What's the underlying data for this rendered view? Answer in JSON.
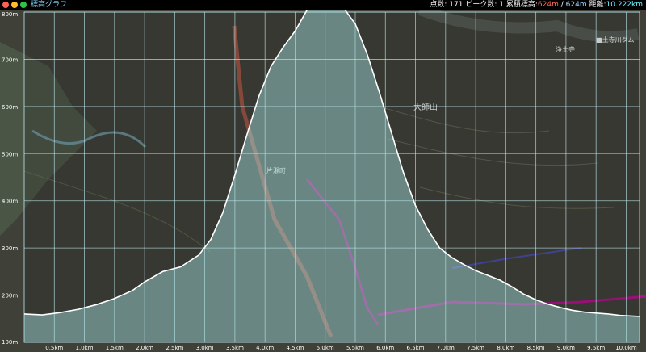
{
  "app": {
    "title": "標高グラフ",
    "stats": {
      "points_label": "点数:",
      "points": "171",
      "peaks_label": "ピーク数:",
      "peaks": "1",
      "gain_label": "累積標高:",
      "gain_up": "624m",
      "sep": "/",
      "gain_down": "624m",
      "distance_label": "距離:",
      "distance": "10.222km"
    }
  },
  "map_labels": {
    "mountain": "大師山",
    "dam": "■土寺川ダム",
    "temple": "浄土寺",
    "town": "片瀬町"
  },
  "colors": {
    "area_fill": "#a8e6e6",
    "line": "#ffffff",
    "grid": "#bfe9f2",
    "route": "#b0108a"
  },
  "chart_data": {
    "type": "area",
    "title": "",
    "xlabel": "",
    "ylabel": "",
    "xlim": [
      0,
      10.222
    ],
    "ylim": [
      100,
      800
    ],
    "x_tick_labels": [
      "0.5km",
      "1.0km",
      "1.5km",
      "2.0km",
      "2.5km",
      "3.0km",
      "3.5km",
      "4.0km",
      "4.5km",
      "5.0km",
      "5.5km",
      "6.0km",
      "6.5km",
      "7.0km",
      "7.5km",
      "8.0km",
      "8.5km",
      "9.0km",
      "9.5km",
      "10.0km"
    ],
    "x_tick_values": [
      0.5,
      1.0,
      1.5,
      2.0,
      2.5,
      3.0,
      3.5,
      4.0,
      4.5,
      5.0,
      5.5,
      6.0,
      6.5,
      7.0,
      7.5,
      8.0,
      8.5,
      9.0,
      9.5,
      10.0
    ],
    "y_tick_labels": [
      "800m",
      "700m",
      "600m",
      "500m",
      "400m",
      "300m",
      "200m",
      "100m"
    ],
    "y_tick_values": [
      800,
      700,
      600,
      500,
      400,
      300,
      200,
      100
    ],
    "grid": true,
    "series": [
      {
        "x": [
          0,
          0.3,
          0.6,
          0.9,
          1.2,
          1.5,
          1.8,
          2.0,
          2.3,
          2.6,
          2.9,
          3.1,
          3.3,
          3.5,
          3.7,
          3.9,
          4.1,
          4.3,
          4.5,
          4.7,
          4.9,
          5.03,
          5.15,
          5.3,
          5.5,
          5.7,
          5.9,
          6.1,
          6.3,
          6.5,
          6.7,
          6.9,
          7.1,
          7.3,
          7.5,
          7.7,
          7.9,
          8.1,
          8.3,
          8.5,
          8.7,
          8.9,
          9.1,
          9.3,
          9.5,
          9.7,
          9.9,
          10.222
        ],
        "y": [
          160,
          158,
          163,
          170,
          180,
          193,
          210,
          228,
          250,
          260,
          285,
          318,
          375,
          455,
          540,
          622,
          685,
          725,
          760,
          805,
          840,
          842,
          830,
          810,
          775,
          710,
          630,
          545,
          460,
          390,
          340,
          300,
          280,
          265,
          252,
          242,
          232,
          218,
          202,
          190,
          181,
          174,
          168,
          164,
          162,
          160,
          157,
          155
        ]
      }
    ]
  }
}
